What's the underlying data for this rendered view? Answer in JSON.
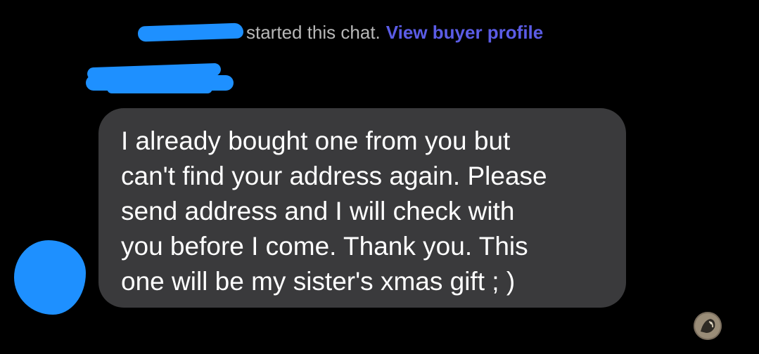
{
  "chat_header": {
    "started_text": "started this chat.",
    "view_profile_label": "View buyer profile"
  },
  "message": {
    "text": "I already bought one from you but\ncan't find your address again.  Please\nsend address and I will check with\nyou before I come.  Thank you.  This\none will be my sister's xmas gift ; )"
  },
  "colors": {
    "background": "#000000",
    "bubble": "#3a3a3c",
    "link": "#5b5ce6",
    "redaction": "#1e90ff"
  }
}
